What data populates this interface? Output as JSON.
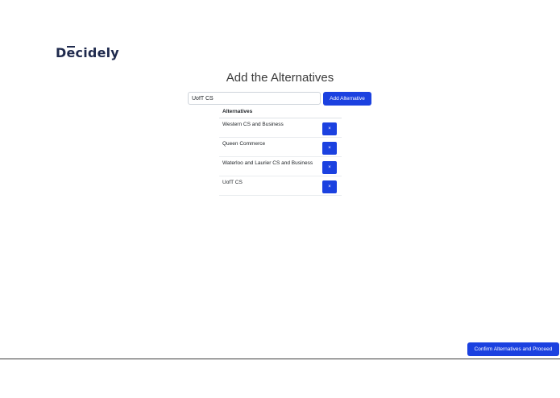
{
  "app": {
    "logo_prefix": "D",
    "logo_mark": "e",
    "logo_suffix": "cidely"
  },
  "page": {
    "title": "Add the Alternatives"
  },
  "form": {
    "input_value": "UofT CS",
    "add_button_label": "Add Alternative"
  },
  "table": {
    "header": "Alternatives",
    "rows": [
      {
        "label": "Western CS and Business",
        "remove_label": "×"
      },
      {
        "label": "Queen Commerce",
        "remove_label": "×"
      },
      {
        "label": "Waterloo and Laurier CS and Business",
        "remove_label": "×"
      },
      {
        "label": "UofT CS",
        "remove_label": "×"
      }
    ]
  },
  "footer": {
    "confirm_label": "Confirm Alternatives and Proceed"
  },
  "colors": {
    "primary": "#1b41e0",
    "logo": "#1f2a4d"
  }
}
